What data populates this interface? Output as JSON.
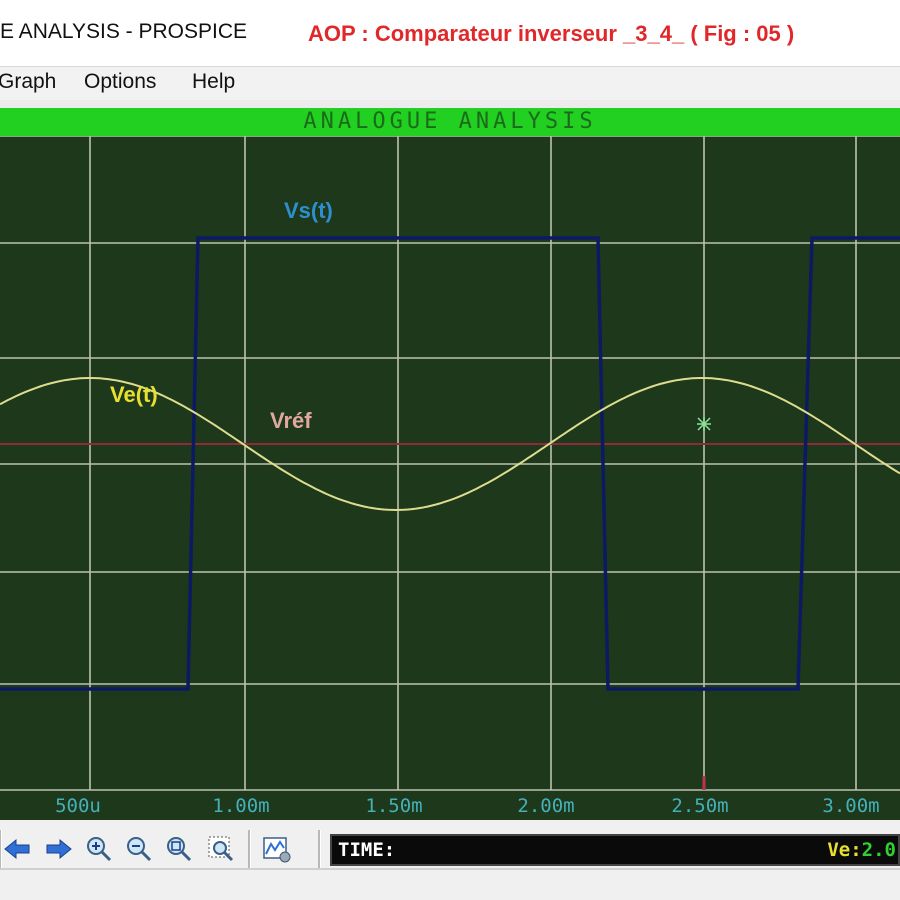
{
  "window": {
    "title": "E ANALYSIS - PROSPICE",
    "caption": "AOP : Comparateur  inverseur _3_4_  ( Fig : 05 )"
  },
  "menu": [
    "Graph",
    "Options",
    "Help"
  ],
  "graph": {
    "header": "ANALOGUE ANALYSIS",
    "x_tick_labels": [
      "500u",
      "1.00m",
      "1.50m",
      "2.00m",
      "2.50m",
      "3.00m"
    ],
    "trace_labels": {
      "vs": "Vs(t)",
      "ve": "Ve(t)",
      "vref": "Vréf"
    }
  },
  "statusbar": {
    "time_label": "TIME:",
    "readout_label": "Ve:",
    "readout_value": "2.0"
  },
  "toolbar_icons": [
    "arrow-left-icon",
    "arrow-right-icon",
    "zoom-in-icon",
    "zoom-out-icon",
    "zoom-all-icon",
    "zoom-area-icon",
    "graph-settings-icon"
  ],
  "colors": {
    "graph_background": "#1e381b",
    "header_bar": "#21d021",
    "grid": "#d8dcc8",
    "vs_trace": "#0c1a63",
    "ve_trace": "#dedc8e",
    "vref_trace": "#8f2a3c",
    "vs_label": "#2e8fce",
    "ve_label": "#e8e030",
    "vref_label": "#e0a8a0",
    "axis_labels": "#44b0b8",
    "caption": "#e0282a"
  }
}
